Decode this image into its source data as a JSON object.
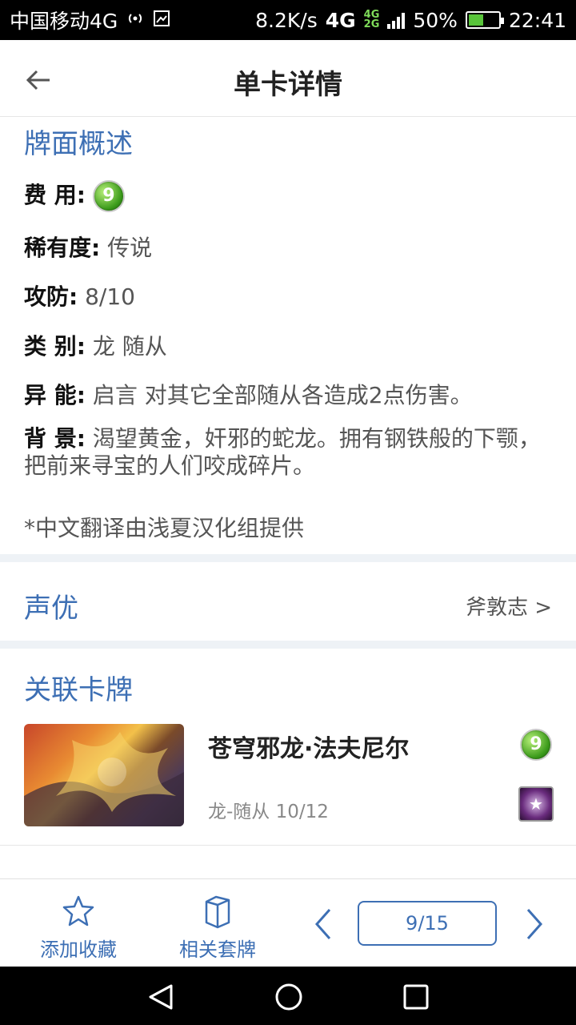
{
  "status": {
    "carrier": "中国移动4G",
    "speed": "8.2K/s",
    "net_main": "4G",
    "net_small_top": "4G",
    "net_small_bottom": "2G",
    "battery": "50%",
    "battery_level": 0.5,
    "time": "22:41"
  },
  "header": {
    "title": "单卡详情"
  },
  "overview": {
    "title": "牌面概述",
    "cost_label": "费 用:",
    "cost_value": "9",
    "rarity_label": "稀有度:",
    "rarity_value": " 传说",
    "attack_label": "攻防:",
    "attack_value": " 8/10",
    "type_label": "类 别:",
    "type_value": " 龙 随从",
    "ability_label": "异 能:",
    "ability_value": " 启言 对其它全部随从各造成2点伤害。",
    "background_label": "背 景:",
    "background_value": " 渴望黄金，奸邪的蛇龙。拥有钢铁般的下颚，把前来寻宝的人们咬成碎片。",
    "note": "*中文翻译由浅夏汉化组提供"
  },
  "voice": {
    "title": "声优",
    "actor": "斧敦志 >"
  },
  "related": {
    "title": "关联卡牌",
    "cards": [
      {
        "name": "苍穹邪龙·法夫尼尔",
        "meta": "龙-随从  10/12",
        "cost": "9",
        "rarity_symbol": "★"
      }
    ]
  },
  "bottombar": {
    "favorite_label": "添加收藏",
    "deck_label": "相关套牌",
    "page": "9/15"
  },
  "colors": {
    "accent": "#3d6fb4",
    "separator": "#eef2f6"
  },
  "icons": [
    "back-arrow-icon",
    "star-icon",
    "card-box-icon",
    "chevron-left-icon",
    "chevron-right-icon",
    "nav-back-icon",
    "nav-home-icon",
    "nav-recent-icon"
  ]
}
